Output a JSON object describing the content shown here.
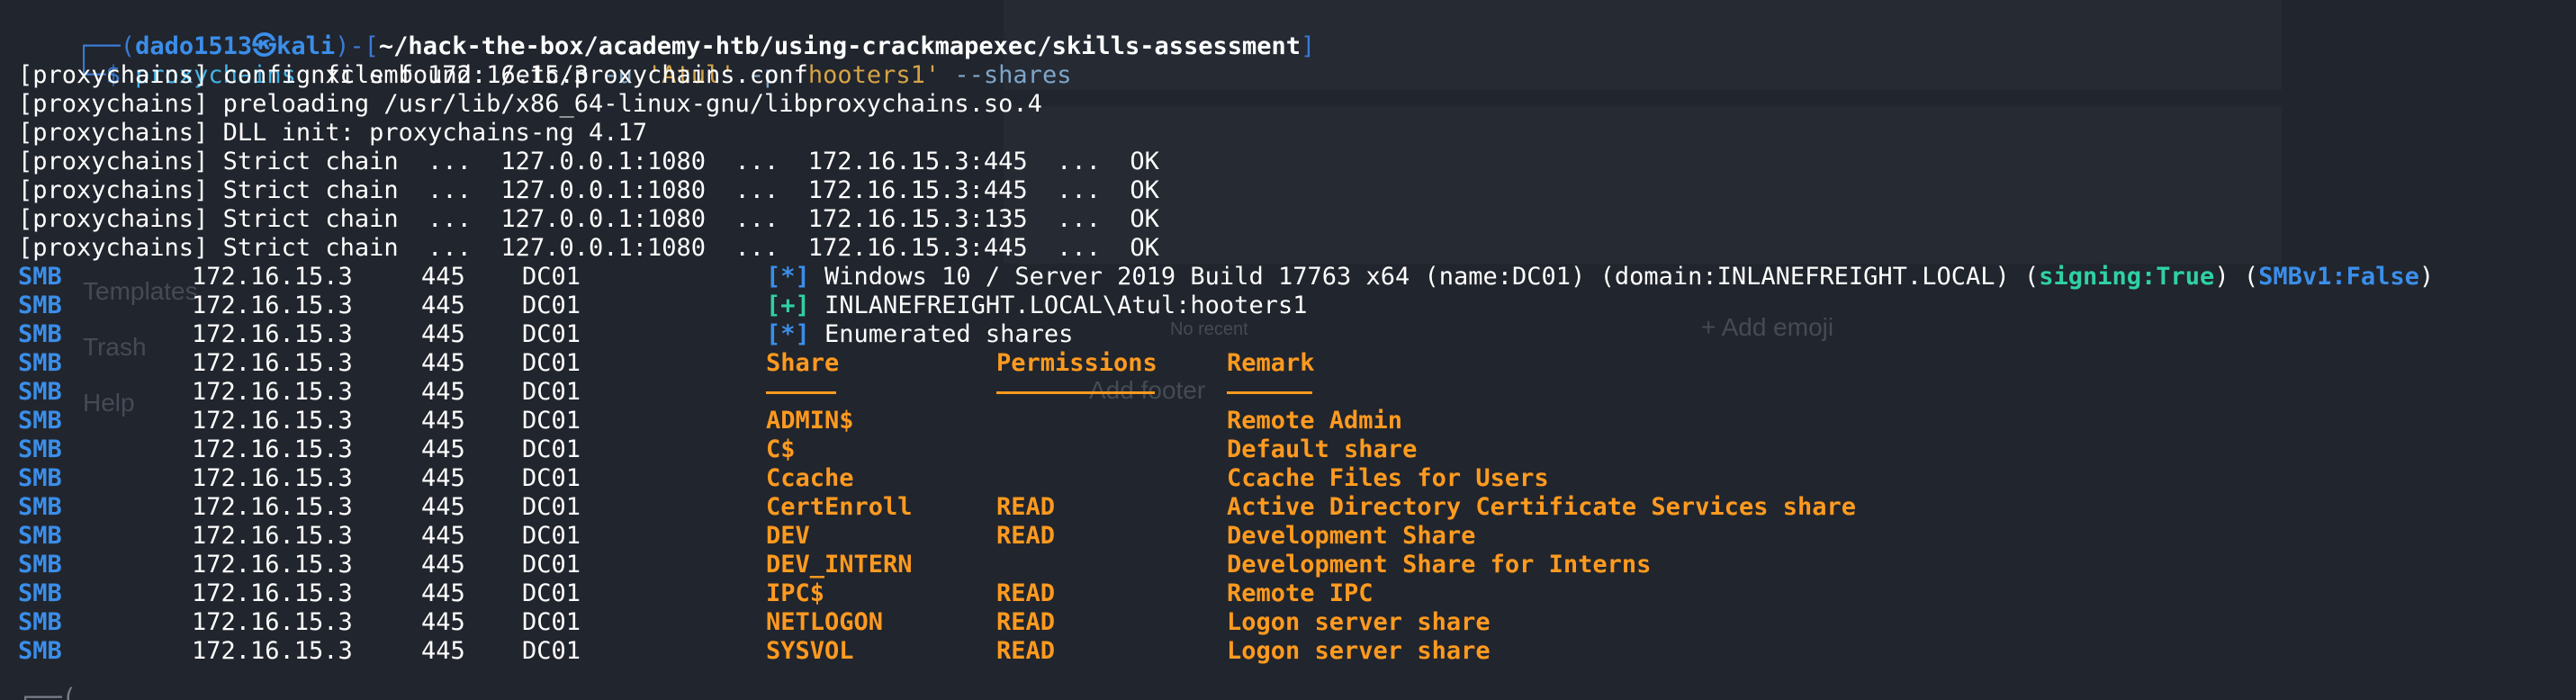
{
  "prompt": {
    "frame_left": "┌──(",
    "user_host": "dado1513㉿kali",
    "frame_mid": ")-[",
    "path": "~/hack-the-box/academy-htb/using-crackmapexec/skills-assessment",
    "frame_right": "]",
    "frame_bottom": "└─$ ",
    "cmd1": "proxychains",
    "cmd2": " nxc smb 172.16.15.3 ",
    "flag_u": "-u",
    "user_val": " 'Atul' ",
    "flag_p": "-p",
    "pass_val": " 'hooters1' ",
    "flag_shares": "--shares"
  },
  "proxychains_lines": [
    "[proxychains] config file found: /etc/proxychains.conf",
    "[proxychains] preloading /usr/lib/x86_64-linux-gnu/libproxychains.so.4",
    "[proxychains] DLL init: proxychains-ng 4.17",
    "[proxychains] Strict chain  ...  127.0.0.1:1080  ...  172.16.15.3:445  ...  OK",
    "[proxychains] Strict chain  ...  127.0.0.1:1080  ...  172.16.15.3:445  ...  OK",
    "[proxychains] Strict chain  ...  127.0.0.1:1080  ...  172.16.15.3:135  ...  OK",
    "[proxychains] Strict chain  ...  127.0.0.1:1080  ...  172.16.15.3:445  ...  OK"
  ],
  "smb_prefix": {
    "proto": "SMB",
    "ip": "172.16.15.3",
    "port": "445",
    "host": "DC01"
  },
  "info_lines": {
    "line1_marker": "[*]",
    "line1_text": " Windows 10 / Server 2019 Build 17763 x64 (name:DC01) (domain:INLANEFREIGHT.LOCAL) (",
    "line1_signing": "signing:True",
    "line1_sep": ") (",
    "line1_smbv1": "SMBv1:False",
    "line1_end": ")",
    "line2_marker": "[+]",
    "line2_text": " INLANEFREIGHT.LOCAL\\Atul:hooters1",
    "line3_marker": "[*]",
    "line3_text": " Enumerated shares"
  },
  "shares_header": {
    "share": "Share",
    "permissions": "Permissions",
    "remark": "Remark"
  },
  "shares": [
    {
      "share": "ADMIN$",
      "permissions": "",
      "remark": "Remote Admin"
    },
    {
      "share": "C$",
      "permissions": "",
      "remark": "Default share"
    },
    {
      "share": "Ccache",
      "permissions": "",
      "remark": "Ccache Files for Users"
    },
    {
      "share": "CertEnroll",
      "permissions": "READ",
      "remark": "Active Directory Certificate Services share"
    },
    {
      "share": "DEV",
      "permissions": "READ",
      "remark": "Development Share"
    },
    {
      "share": "DEV_INTERN",
      "permissions": "",
      "remark": "Development Share for Interns"
    },
    {
      "share": "IPC$",
      "permissions": "READ",
      "remark": "Remote IPC"
    },
    {
      "share": "NETLOGON",
      "permissions": "READ",
      "remark": "Logon server share"
    },
    {
      "share": "SYSVOL",
      "permissions": "READ",
      "remark": "Logon server share"
    }
  ],
  "background_ghost": {
    "menu": [
      "Templates",
      "Trash",
      "Help"
    ],
    "add_emoji": "+ Add emoji",
    "no_recent": "No recent",
    "add_footer": "Add footer"
  },
  "colors": {
    "background": "#21252d",
    "smb_blue": "#3b8eea",
    "orange": "#ff9a1f",
    "green": "#2fd1a4",
    "cyan": "#43b3e8"
  }
}
